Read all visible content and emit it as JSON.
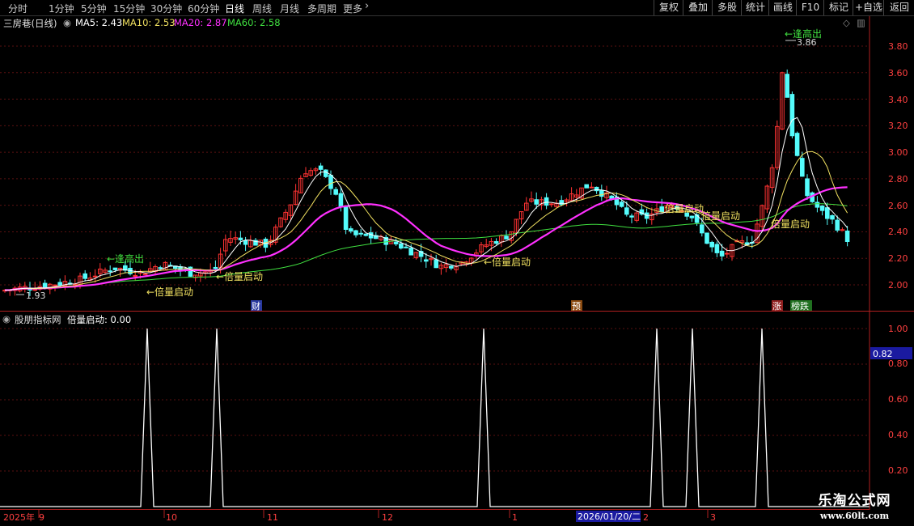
{
  "toolbar": {
    "periods": [
      "分时",
      "1分钟",
      "5分钟",
      "15分钟",
      "30分钟",
      "60分钟",
      "日线",
      "周线",
      "月线",
      "多周期",
      "更多"
    ],
    "active_period": "日线",
    "more_chevron": "chevron-right-icon",
    "buttons": [
      "复权",
      "叠加",
      "多股",
      "统计",
      "画线",
      "F10",
      "标记",
      "+自选",
      "返回"
    ]
  },
  "main": {
    "title": "三房巷(日线)",
    "ma": [
      {
        "label": "MA5: 2.43",
        "color": "#ffffff"
      },
      {
        "label": "MA10: 2.53",
        "color": "#f0e060"
      },
      {
        "label": "MA20: 2.87",
        "color": "#ff30ff"
      },
      {
        "label": "MA60: 2.58",
        "color": "#40e040"
      }
    ],
    "price_axis": [
      "3.80",
      "3.60",
      "3.40",
      "3.20",
      "3.00",
      "2.80",
      "2.60",
      "2.40",
      "2.20",
      "2.00"
    ],
    "high_label": "3.86",
    "low_label": "1.93",
    "annotations": [
      "←倍量启动",
      "←倍量启动",
      "←倍量启动",
      "倍量启动",
      "倍量启动",
      "倍量启动",
      "←逢高出",
      "←逢高出"
    ],
    "event_markers": [
      "财",
      "预",
      "涨",
      "榜跌"
    ],
    "colors": {
      "up": "#ff3232",
      "down": "#54fcfc",
      "ma5": "#ffffff",
      "ma10": "#f0e060",
      "ma20": "#ff30ff",
      "ma60": "#40e040"
    }
  },
  "indicator": {
    "title": "股朋指标网",
    "formula": "倍量启动: 0.00",
    "axis": [
      "1.00",
      "0.80",
      "0.60",
      "0.40",
      "0.20"
    ],
    "current_value": "0.82"
  },
  "date_axis": {
    "labels": [
      "2025年",
      "9",
      "10",
      "11",
      "12",
      "1",
      "2",
      "3"
    ],
    "cursor_date": "2026/01/20/二"
  },
  "watermark": {
    "title": "乐淘公式网",
    "url": "www.60lt.com"
  }
}
